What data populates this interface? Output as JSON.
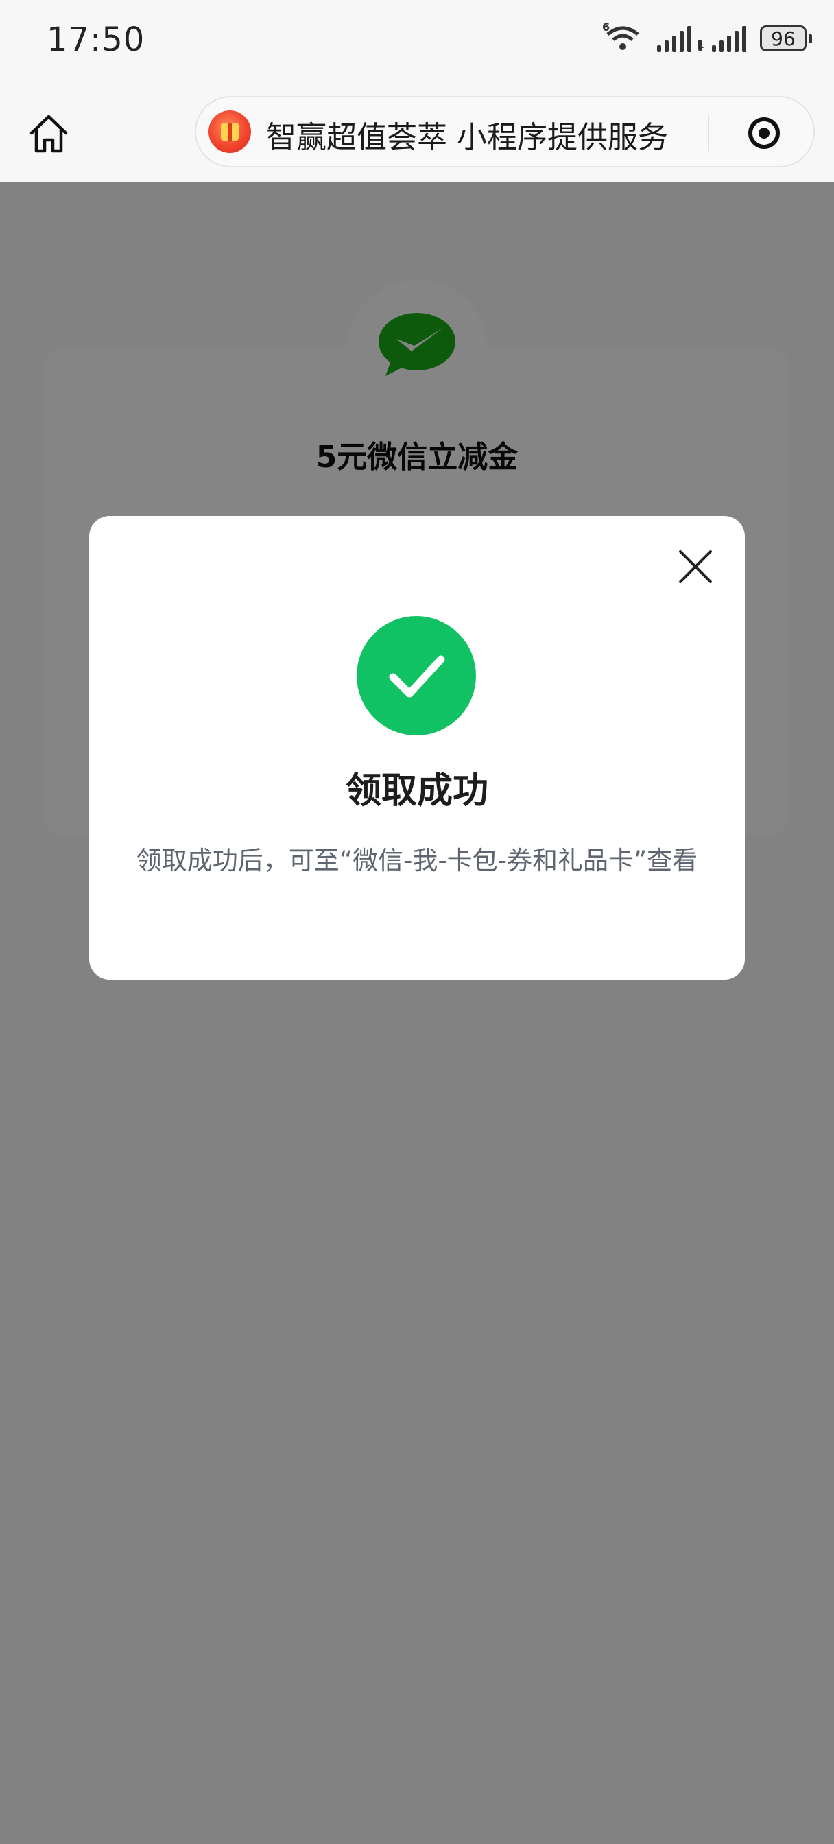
{
  "status_bar": {
    "time": "17:50",
    "network_label": "6",
    "signal_sup": "1",
    "battery": "96"
  },
  "nav": {
    "home_icon": "home-icon",
    "mini_program_title": "智赢超值荟萃 小程序提供服务",
    "logo_icon": "gift-box-logo-icon",
    "menu_icon": "target-icon"
  },
  "coupon": {
    "icon": "wechat-pay-icon",
    "title": "5元微信立减金"
  },
  "modal": {
    "status_icon": "check-circle-icon",
    "title": "领取成功",
    "description": "领取成功后，可至“微信-我-卡包-券和礼品卡”查看",
    "close_icon": "close-icon"
  },
  "colors": {
    "success_green": "#11c265",
    "wechat_green": "#1aad19",
    "mask": "rgba(0,0,0,0.48)"
  }
}
